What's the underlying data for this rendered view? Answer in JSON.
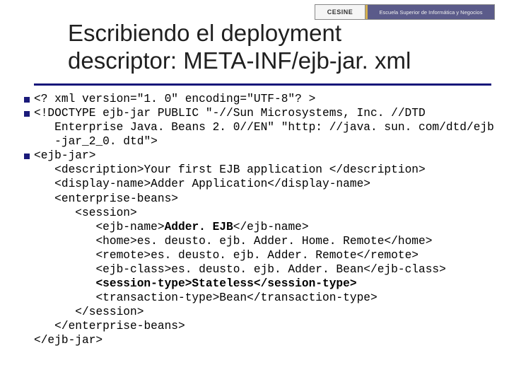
{
  "banner": {
    "logo": "CESINE",
    "tagline": "Escuela Superior de Informática y Negocios"
  },
  "title_line1": "Escribiendo el deployment",
  "title_line2": "descriptor: META-INF/ejb-jar. xml",
  "code": {
    "l1": "<? xml version=\"1. 0\" encoding=\"UTF-8\"? >",
    "l2a": "<!DOCTYPE ejb-jar PUBLIC \"-//Sun Microsystems, Inc. //DTD",
    "l2b": "Enterprise Java. Beans 2. 0//EN\" \"http: //java. sun. com/dtd/ejb",
    "l2c": "-jar_2_0. dtd\">",
    "l3": "<ejb-jar>",
    "l4": "<description>Your first EJB application </description>",
    "l5": "<display-name>Adder Application</display-name>",
    "l6": "<enterprise-beans>",
    "l7": "<session>",
    "l8a": "<ejb-name>",
    "l8b": "Adder. EJB",
    "l8c": "</ejb-name>",
    "l9": "<home>es. deusto. ejb. Adder. Home. Remote</home>",
    "l10": "<remote>es. deusto. ejb. Adder. Remote</remote>",
    "l11": "<ejb-class>es. deusto. ejb. Adder. Bean</ejb-class>",
    "l12": "<session-type>Stateless</session-type>",
    "l13": "<transaction-type>Bean</transaction-type>",
    "l14": "</session>",
    "l15": "</enterprise-beans>",
    "l16": "</ejb-jar>"
  }
}
